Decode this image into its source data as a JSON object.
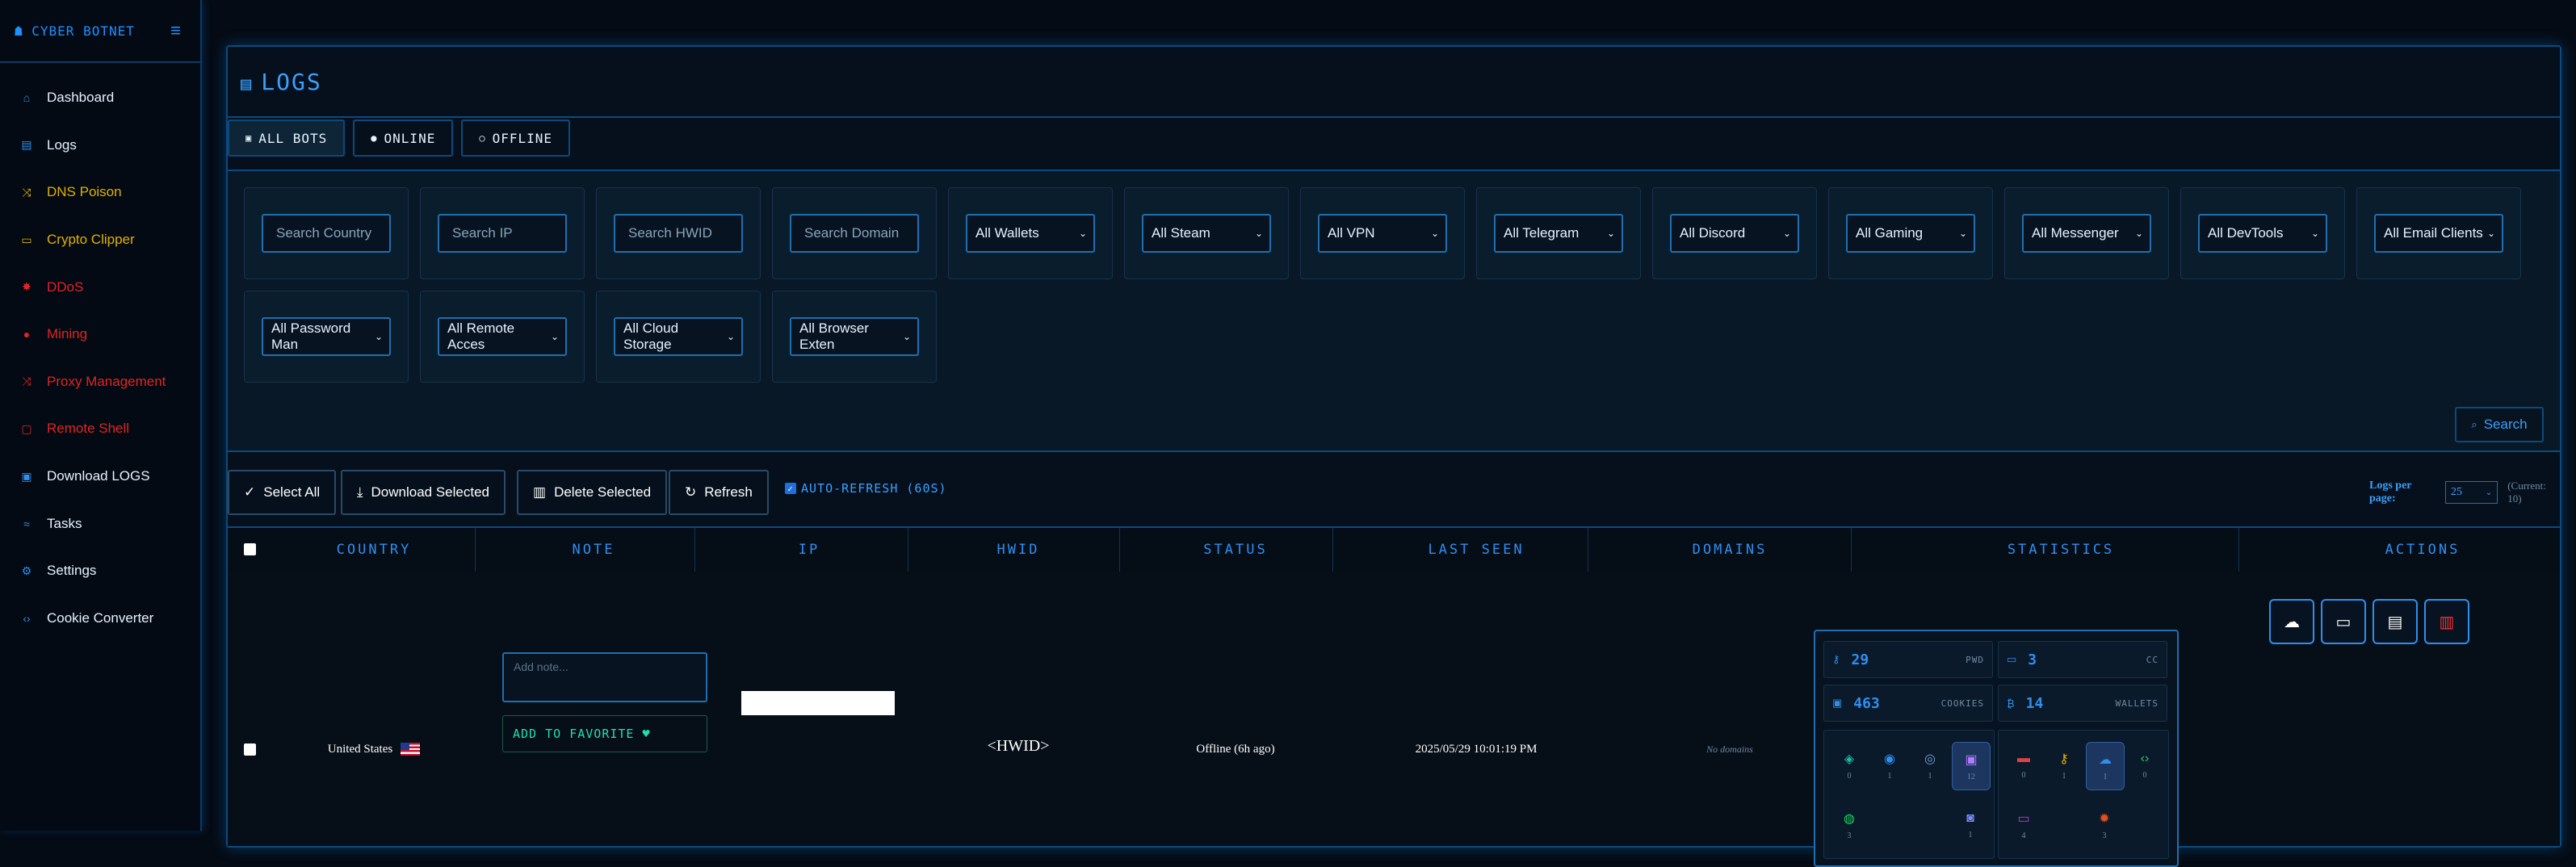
{
  "brand": {
    "title": "CYBER BOTNET",
    "toggle_icon": "≡"
  },
  "sidebar": {
    "items": [
      {
        "label": "Dashboard",
        "icon": "home-icon",
        "glyph": "⌂",
        "color": "#e6f2ff"
      },
      {
        "label": "Logs",
        "icon": "file-icon",
        "glyph": "▤",
        "color": "#e6f2ff"
      },
      {
        "label": "DNS Poison",
        "icon": "shuffle-icon",
        "glyph": "⤨",
        "color": "#e0b000"
      },
      {
        "label": "Crypto Clipper",
        "icon": "card-icon",
        "glyph": "▭",
        "color": "#e0b000"
      },
      {
        "label": "DDoS",
        "icon": "bolt-icon",
        "glyph": "✸",
        "color": "#e02424"
      },
      {
        "label": "Mining",
        "icon": "circle-icon",
        "glyph": "●",
        "color": "#e02424"
      },
      {
        "label": "Proxy Management",
        "icon": "shuffle-icon",
        "glyph": "⤨",
        "color": "#e02424"
      },
      {
        "label": "Remote Shell",
        "icon": "monitor-icon",
        "glyph": "▢",
        "color": "#e02424"
      },
      {
        "label": "Download LOGS",
        "icon": "download-icon",
        "glyph": "▣",
        "color": "#e6f2ff"
      },
      {
        "label": "Tasks",
        "icon": "tasks-icon",
        "glyph": "≈",
        "color": "#e6f2ff"
      },
      {
        "label": "Settings",
        "icon": "gear-icon",
        "glyph": "⚙",
        "color": "#e6f2ff"
      },
      {
        "label": "Cookie Converter",
        "icon": "code-icon",
        "glyph": "‹›",
        "color": "#e6f2ff"
      }
    ]
  },
  "page": {
    "title": "LOGS"
  },
  "tabs": [
    {
      "label": "ALL BOTS",
      "glyph": "▣"
    },
    {
      "label": "ONLINE",
      "glyph": "●"
    },
    {
      "label": "OFFLINE",
      "glyph": "○"
    }
  ],
  "filters": {
    "inputs": [
      {
        "placeholder": "Search Country"
      },
      {
        "placeholder": "Search IP"
      },
      {
        "placeholder": "Search HWID"
      },
      {
        "placeholder": "Search Domain"
      }
    ],
    "selects_row1": [
      "All Wallets",
      "All Steam",
      "All VPN",
      "All Telegram",
      "All Discord",
      "All Gaming",
      "All Messenger",
      "All DevTools",
      "All Email Clients"
    ],
    "selects_row2": [
      "All Password Man",
      "All Remote Acces",
      "All Cloud Storage",
      "All Browser Exten"
    ],
    "search_label": "Search"
  },
  "toolbar": {
    "select_all": "Select All",
    "download_selected": "Download Selected",
    "delete_selected": "Delete Selected",
    "refresh": "Refresh",
    "auto_refresh": "AUTO-REFRESH (60S)",
    "logs_per_page_label": "Logs per page:",
    "logs_per_page_value": "25",
    "current": "(Current: 10)"
  },
  "table": {
    "columns": [
      "COUNTRY",
      "NOTE",
      "IP",
      "HWID",
      "STATUS",
      "LAST SEEN",
      "DOMAINS",
      "STATISTICS",
      "ACTIONS"
    ],
    "row": {
      "country": "United States",
      "note_placeholder": "Add note...",
      "favorite_label": "ADD TO FAVORITE",
      "hwid": "<HWID>",
      "status": "Offline (6h ago)",
      "last_seen": "2025/05/29 10:01:19 PM",
      "domains": "No domains",
      "stats": {
        "pwd": {
          "value": "29",
          "key": "PWD"
        },
        "cc": {
          "value": "3",
          "key": "CC"
        },
        "cookies": {
          "value": "463",
          "key": "COOKIES"
        },
        "wallets": {
          "value": "14",
          "key": "WALLETS"
        },
        "group_a": [
          {
            "icon": "vpn-shield-icon",
            "n": "0",
            "color": "#1fb8a8"
          },
          {
            "icon": "globe-icon",
            "n": "1",
            "color": "#2f8ff0"
          },
          {
            "icon": "steam-icon",
            "n": "1",
            "color": "#6f9fd0"
          },
          {
            "icon": "gamepad-icon",
            "n": "12",
            "color": "#b07cff"
          },
          {
            "icon": "chat-icon",
            "n": "3",
            "color": "#1fd060"
          },
          {
            "icon": "discord-icon",
            "n": "1",
            "color": "#7a8cff"
          }
        ],
        "group_b": [
          {
            "icon": "mail-icon",
            "n": "0",
            "color": "#e04040"
          },
          {
            "icon": "key-icon",
            "n": "1",
            "color": "#e0b000"
          },
          {
            "icon": "cloud-icon",
            "n": "1",
            "color": "#2f8ff0"
          },
          {
            "icon": "code-icon",
            "n": "0",
            "color": "#1fd060"
          },
          {
            "icon": "remote-desktop-icon",
            "n": "4",
            "color": "#b040d0"
          },
          {
            "icon": "puzzle-icon",
            "n": "3",
            "color": "#e05020"
          }
        ]
      }
    }
  }
}
